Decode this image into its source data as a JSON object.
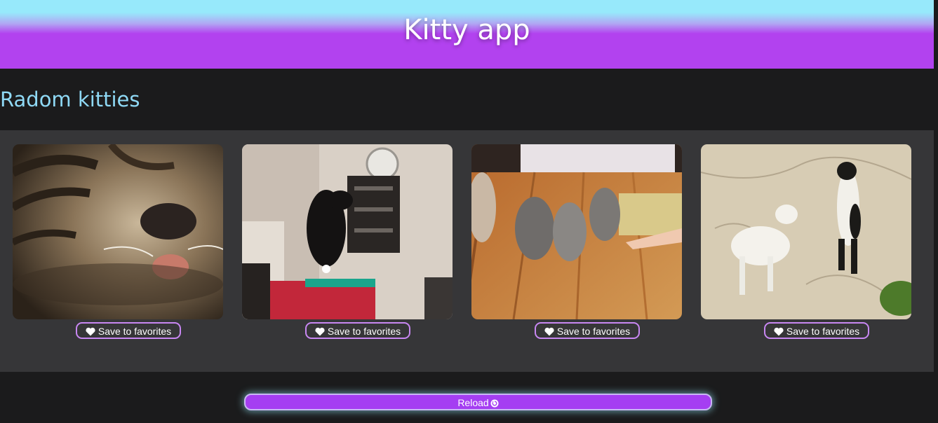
{
  "header": {
    "title": "Kitty app"
  },
  "section": {
    "title": "Radom kitties"
  },
  "cards": [
    {
      "button_label": "Save to favorites",
      "icon": "heart-icon",
      "photo": "tabby cat lying upside down close-up"
    },
    {
      "button_label": "Save to favorites",
      "icon": "heart-icon",
      "photo": "black cat climbing a shelf in a room"
    },
    {
      "button_label": "Save to favorites",
      "icon": "heart-icon",
      "photo": "three kittens on a wooden floor"
    },
    {
      "button_label": "Save to favorites",
      "icon": "heart-icon",
      "photo": "white cat and standing black-and-white cat"
    }
  ],
  "reload": {
    "label": "Reload",
    "icon": "refresh-icon"
  },
  "colors": {
    "header_top": "#97e9fb",
    "header_bottom": "#b242ef",
    "accent_purple": "#a53ef2",
    "section_title": "#8fd9f5",
    "page_background": "#1b1b1c",
    "gallery_background": "#363638"
  }
}
